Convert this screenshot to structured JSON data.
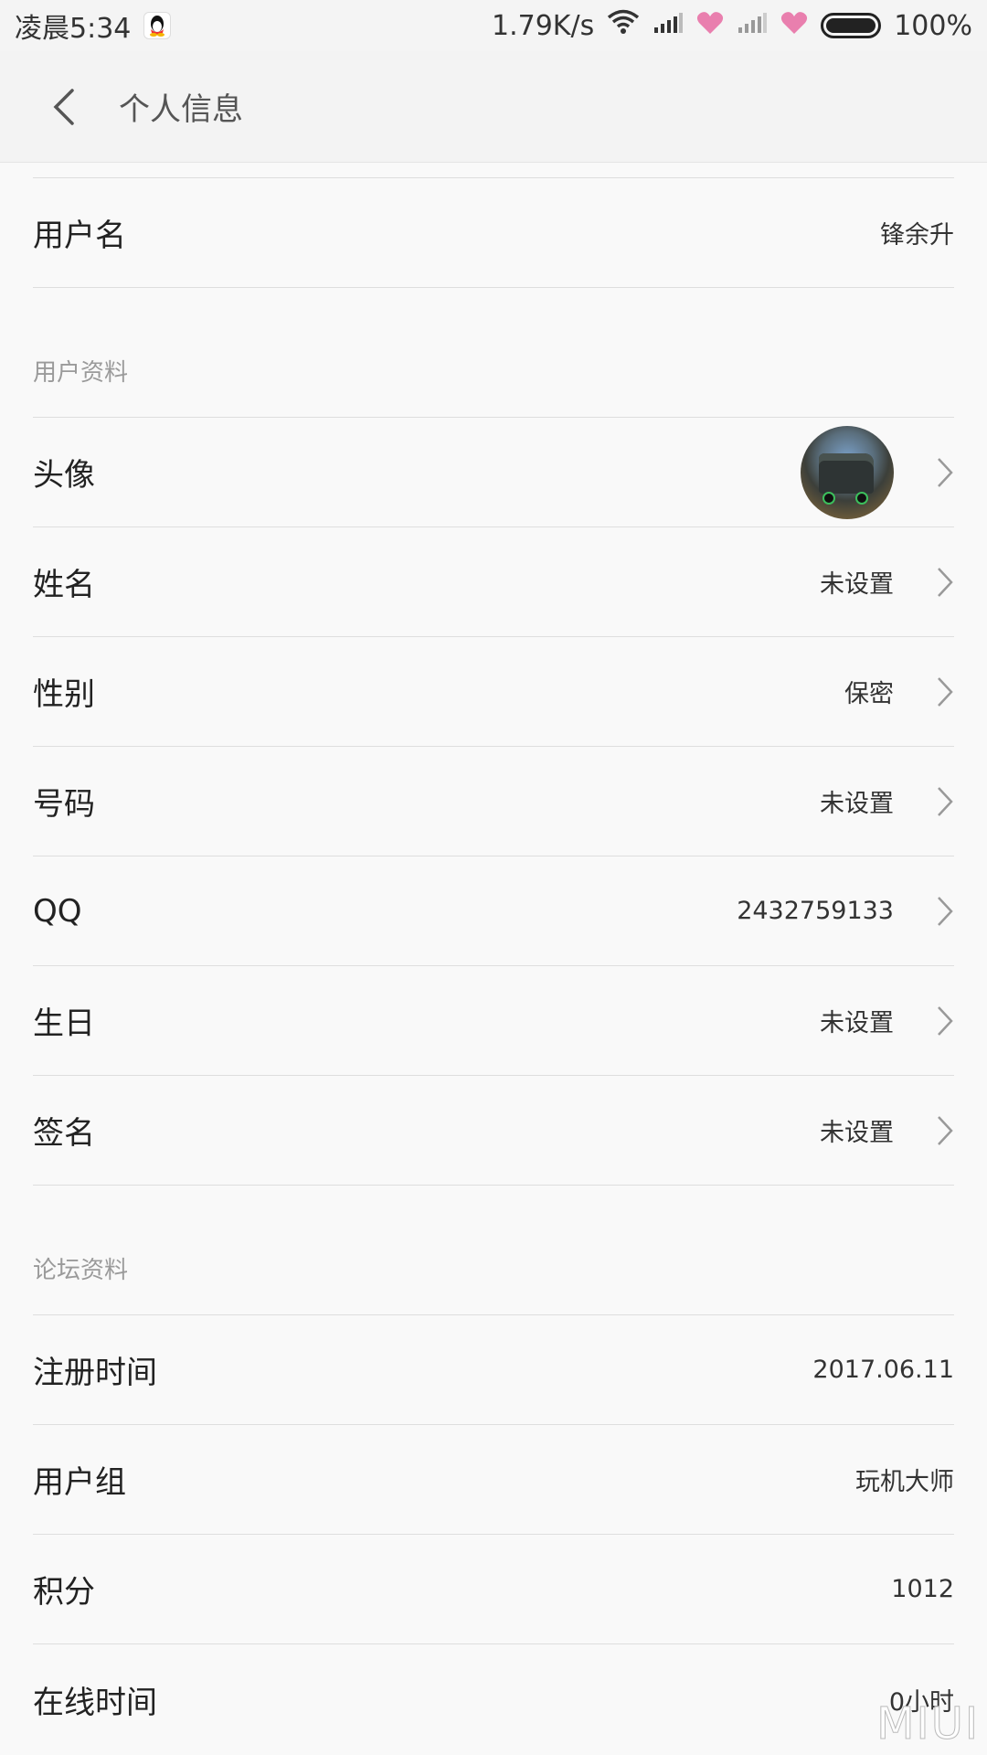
{
  "status_bar": {
    "time": "凌晨5:34",
    "speed": "1.79K/s",
    "battery": "100%"
  },
  "header": {
    "title": "个人信息"
  },
  "account": {
    "username_label": "用户名",
    "username_value": "锋余升"
  },
  "user_profile": {
    "section_title": "用户资料",
    "rows": [
      {
        "label": "头像",
        "value": ""
      },
      {
        "label": "姓名",
        "value": "未设置"
      },
      {
        "label": "性别",
        "value": "保密"
      },
      {
        "label": "号码",
        "value": "未设置"
      },
      {
        "label": "QQ",
        "value": "2432759133"
      },
      {
        "label": "生日",
        "value": "未设置"
      },
      {
        "label": "签名",
        "value": "未设置"
      }
    ]
  },
  "forum_profile": {
    "section_title": "论坛资料",
    "rows": [
      {
        "label": "注册时间",
        "value": "2017.06.11"
      },
      {
        "label": "用户组",
        "value": "玩机大师"
      },
      {
        "label": "积分",
        "value": "1012"
      },
      {
        "label": "在线时间",
        "value": "0小时"
      }
    ]
  },
  "watermark": "MIUI",
  "colors": {
    "heart": "#e97fae",
    "background": "#f9f9f9",
    "divider": "#dedede"
  }
}
